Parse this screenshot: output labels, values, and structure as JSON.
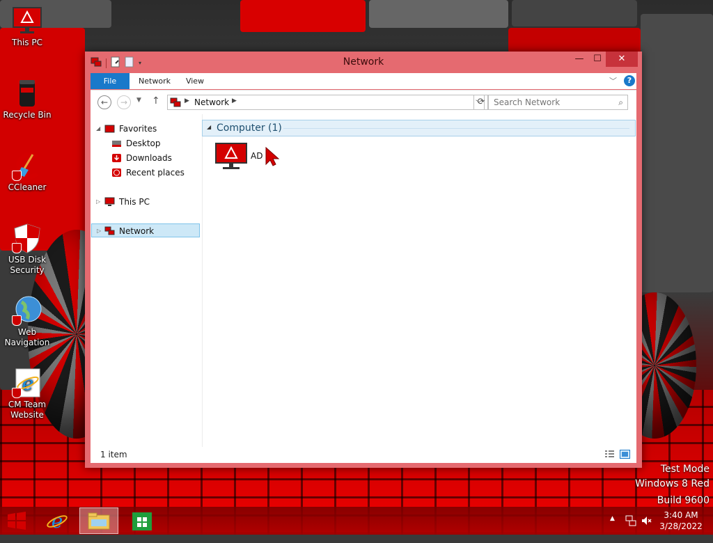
{
  "desktop": {
    "icons": [
      {
        "label": "This PC",
        "icon": "monitor-icon"
      },
      {
        "label": "Recycle Bin",
        "icon": "recycle-bin-icon"
      },
      {
        "label": "CCleaner",
        "icon": "ccleaner-icon"
      },
      {
        "label": "USB Disk Security",
        "icon": "usb-shield-icon"
      },
      {
        "label": "Web Navigation",
        "icon": "globe-icon"
      },
      {
        "label": "CM Team Website",
        "icon": "internet-explorer-icon"
      }
    ],
    "watermark": {
      "line1": "Test Mode",
      "line2": "Windows 8 Red",
      "line3": "Build 9600"
    }
  },
  "window": {
    "title": "Network",
    "controls": {
      "minimize": "—",
      "maximize": "☐",
      "close": "✕"
    },
    "ribbon": {
      "tabs": [
        "File",
        "Network",
        "View"
      ],
      "help": "?"
    },
    "address": {
      "crumb": "Network",
      "search_placeholder": "Search Network"
    },
    "navpane": {
      "favorites_label": "Favorites",
      "favorites": [
        "Desktop",
        "Downloads",
        "Recent places"
      ],
      "this_pc": "This PC",
      "network": "Network"
    },
    "content": {
      "group_header": "Computer (1)",
      "items": [
        {
          "label": "AD",
          "icon": "monitor-icon"
        }
      ]
    },
    "status": {
      "count": "1 item"
    }
  },
  "taskbar": {
    "time": "3:40 AM",
    "date": "3/28/2022",
    "tray_overflow": "▲"
  },
  "colors": {
    "window_frame": "#e56a70",
    "close_button": "#c7323b",
    "file_tab": "#1979ca",
    "selection": "#cde8f7",
    "accent_red": "#d10000"
  }
}
